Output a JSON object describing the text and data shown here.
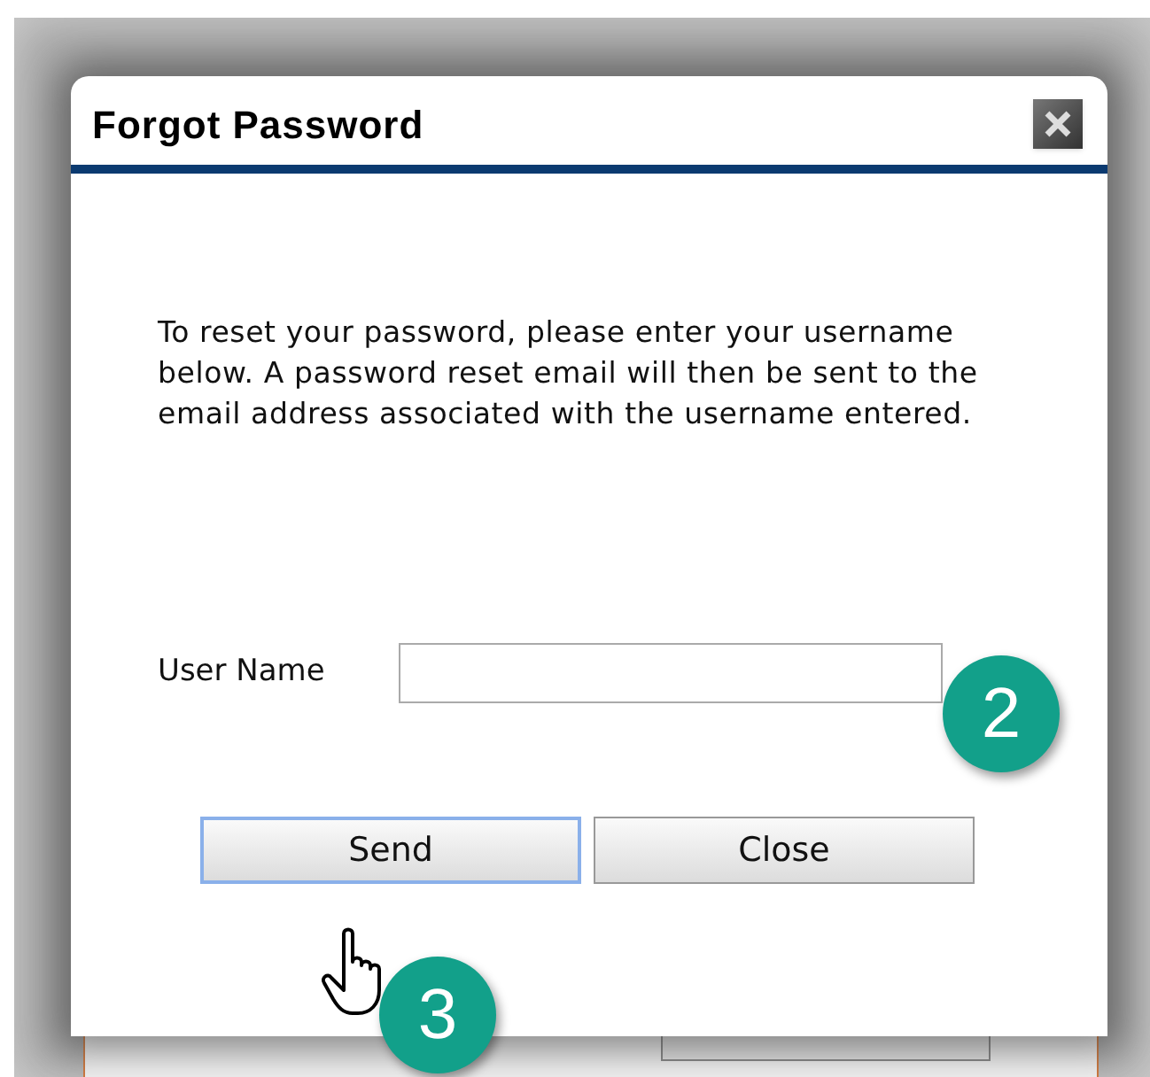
{
  "dialog": {
    "title": "Forgot Password",
    "message": "To reset your password, please enter your username below. A password reset email will then be sent to the email address associated with the username entered.",
    "field": {
      "label": "User Name"
    },
    "buttons": [
      {
        "label": "Send",
        "focused": true
      },
      {
        "label": "Close",
        "focused": false
      }
    ]
  },
  "callouts": [
    {
      "label": "2"
    },
    {
      "label": "3"
    }
  ]
}
